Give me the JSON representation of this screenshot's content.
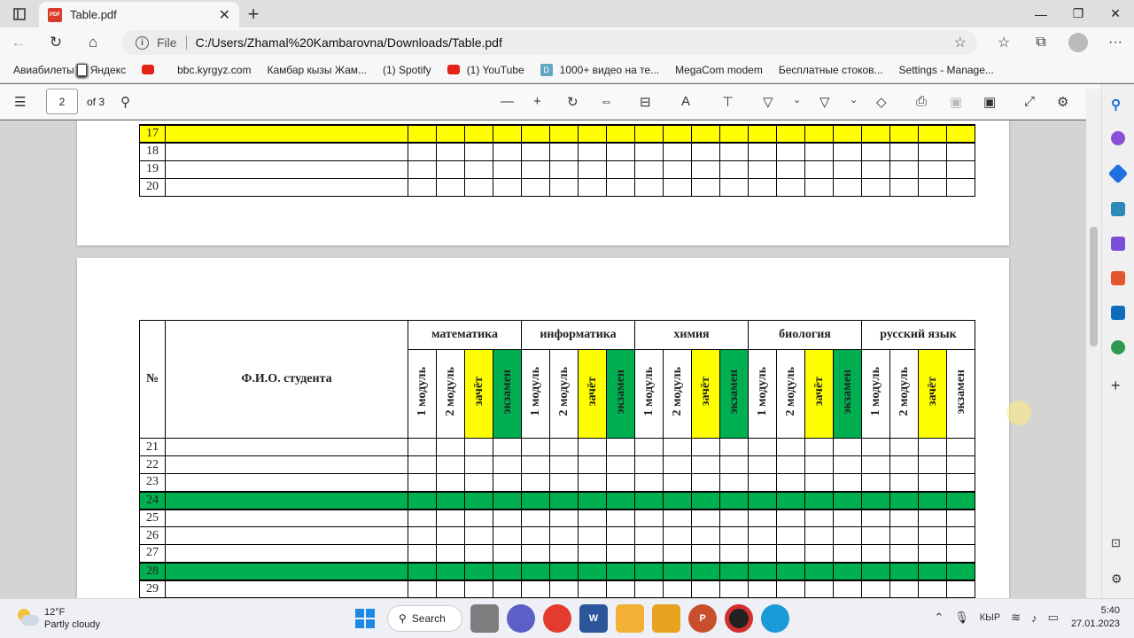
{
  "browser": {
    "tab_title": "Table.pdf",
    "address_prefix": "File",
    "url": "C:/Users/Zhamal%20Kambarovna/Downloads/Table.pdf"
  },
  "bookmarks": [
    "Авиабилеты",
    "Яндекс",
    "",
    "bbc.kyrgyz.com",
    "Камбар кызы Жам...",
    "(1) Spotify",
    "(1) YouTube",
    "1000+ видео на те...",
    "MegaCom modem",
    "Бесплатные стоков...",
    "Settings - Manage..."
  ],
  "pdf_toolbar": {
    "page_number": "2",
    "page_total": "of 3"
  },
  "table_top": {
    "rows": [
      {
        "num": "17",
        "color": "yellow"
      },
      {
        "num": "18",
        "color": ""
      },
      {
        "num": "19",
        "color": ""
      },
      {
        "num": "20",
        "color": ""
      }
    ]
  },
  "table_bottom": {
    "col_no": "№",
    "col_name": "Ф.И.О. студента",
    "subjects": [
      "математика",
      "информатика",
      "химия",
      "биология",
      "русский язык"
    ],
    "subcols": [
      "1 модуль",
      "2 модуль",
      "зачёт",
      "экзамен"
    ],
    "rows": [
      {
        "num": "21",
        "color": ""
      },
      {
        "num": "22",
        "color": ""
      },
      {
        "num": "23",
        "color": ""
      },
      {
        "num": "24",
        "color": "green"
      },
      {
        "num": "25",
        "color": ""
      },
      {
        "num": "26",
        "color": ""
      },
      {
        "num": "27",
        "color": ""
      },
      {
        "num": "28",
        "color": "green"
      },
      {
        "num": "29",
        "color": ""
      }
    ]
  },
  "taskbar": {
    "temp": "12°F",
    "weather": "Partly cloudy",
    "search": "Search",
    "lang": "КЫР",
    "time": "5:40",
    "date": "27.01.2023"
  },
  "colors": {
    "yellow": "#ffff00",
    "green": "#00b050"
  }
}
